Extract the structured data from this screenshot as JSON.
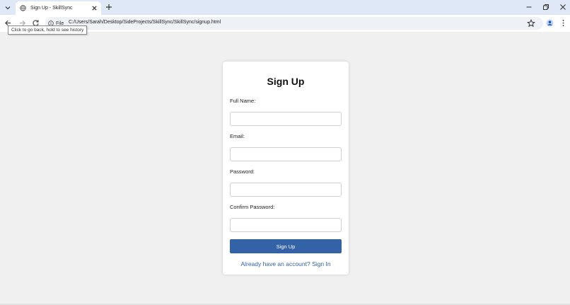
{
  "browser": {
    "tab": {
      "title": "Sign Up - SkillSync"
    },
    "address_bar": {
      "site_label": "File",
      "url": "C:/Users/Sarah/Desktop/SideProjects/SkillSync/SkillSync/signup.html"
    },
    "tooltip": "Click to go back, hold to see history",
    "icons": [
      "tab-search-icon",
      "globe-icon",
      "close-icon",
      "plus-icon",
      "minimize-icon",
      "restore-icon",
      "window-close-icon",
      "back-arrow-icon",
      "forward-arrow-icon",
      "reload-icon",
      "info-icon",
      "star-icon",
      "profile-icon",
      "kebab-menu-icon"
    ]
  },
  "signup": {
    "title": "Sign Up",
    "fields": [
      {
        "label": "Full Name:",
        "value": ""
      },
      {
        "label": "Email:",
        "value": ""
      },
      {
        "label": "Password:",
        "value": ""
      },
      {
        "label": "Confirm Password:",
        "value": ""
      }
    ],
    "submit_label": "Sign Up",
    "signin_prompt": "Already have an account? Sign In"
  },
  "colors": {
    "accent": "#3462a7",
    "page_background": "#f0f0f0",
    "tabstrip_background": "#dfe8f6"
  }
}
